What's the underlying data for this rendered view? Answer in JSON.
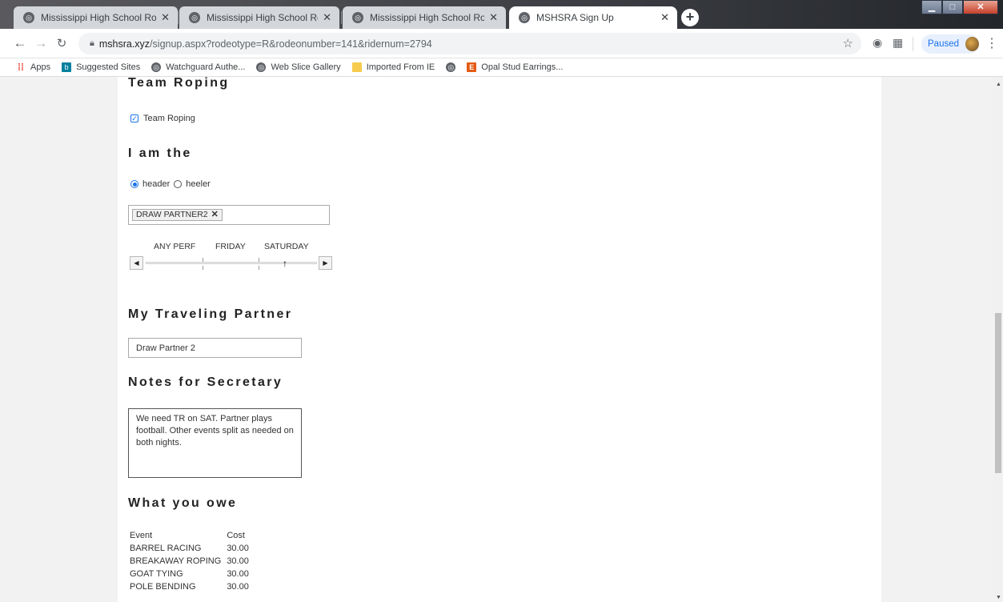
{
  "browser": {
    "tabs": [
      {
        "title": "Mississippi High School Rodeo A",
        "active": false
      },
      {
        "title": "Mississippi High School Rodeo A",
        "active": false
      },
      {
        "title": "Mississippi High School Rodeo A",
        "active": false
      },
      {
        "title": "MSHSRA Sign Up",
        "active": true
      }
    ],
    "url_host": "mshsra.xyz",
    "url_path": "/signup.aspx?rodeotype=R&rodeonumber=141&ridernum=2794",
    "profile_status": "Paused",
    "bookmarks": [
      {
        "label": "Apps",
        "icon": "apps-grid-icon"
      },
      {
        "label": "Suggested Sites",
        "icon": "bing-icon"
      },
      {
        "label": "Watchguard Authe...",
        "icon": "globe-icon"
      },
      {
        "label": "Web Slice Gallery",
        "icon": "globe-icon"
      },
      {
        "label": "Imported From IE",
        "icon": "folder-icon"
      },
      {
        "label": "",
        "icon": "globe-icon"
      },
      {
        "label": "Opal Stud Earrings...",
        "icon": "etsy-icon"
      }
    ]
  },
  "form": {
    "event_heading": "Team Roping",
    "event_checkbox_label": "Team Roping",
    "event_checked": true,
    "role_heading": "I am the",
    "role_options": [
      {
        "label": "header",
        "selected": true
      },
      {
        "label": "heeler",
        "selected": false
      }
    ],
    "partner_tag": "DRAW PARTNER2",
    "perf_options": [
      "ANY PERF",
      "FRIDAY",
      "SATURDAY"
    ],
    "perf_selected": "SATURDAY",
    "traveling_heading": "My Traveling Partner",
    "traveling_value": "Draw Partner 2",
    "notes_heading": "Notes for Secretary",
    "notes_value": "We need TR on SAT. Partner plays football. Other events split as needed on both nights.",
    "owe_heading": "What you owe",
    "owe_columns": [
      "Event",
      "Cost"
    ],
    "owe_rows": [
      {
        "event": "BARREL RACING",
        "cost": "30.00"
      },
      {
        "event": "BREAKAWAY ROPING",
        "cost": "30.00"
      },
      {
        "event": "GOAT TYING",
        "cost": "30.00"
      },
      {
        "event": "POLE BENDING",
        "cost": "30.00"
      }
    ]
  },
  "colors": {
    "accent": "#1a73e8",
    "page_bg": "#f2f2f2"
  }
}
